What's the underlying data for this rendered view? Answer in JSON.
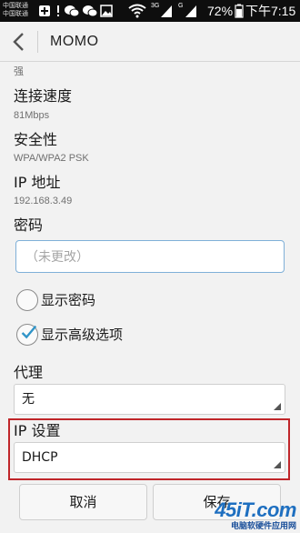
{
  "status_bar": {
    "carrier_1": "中国联通",
    "carrier_2": "中国联通",
    "network_label": "3G",
    "data_label": "G",
    "battery_percent": "72%",
    "time": "下午7:15",
    "battery_level": 0.72,
    "icons": [
      "add-icon",
      "notification-icon",
      "wechat-icon",
      "wechat-icon",
      "image-icon",
      "wifi-icon",
      "signal-icon",
      "signal-icon",
      "battery-icon"
    ]
  },
  "action_bar": {
    "back_icon": "chevron-left-icon",
    "title": "MOMO"
  },
  "signal_strength": {
    "value": "强"
  },
  "link_speed": {
    "label": "连接速度",
    "value": "81Mbps"
  },
  "security": {
    "label": "安全性",
    "value": "WPA/WPA2 PSK"
  },
  "ip_address": {
    "label": "IP 地址",
    "value": "192.168.3.49"
  },
  "password": {
    "label": "密码",
    "placeholder": "（未更改）"
  },
  "options": {
    "show_password": {
      "label": "显示密码",
      "checked": false
    },
    "show_advanced": {
      "label": "显示高级选项",
      "checked": true
    }
  },
  "proxy": {
    "label": "代理",
    "selected": "无"
  },
  "ip_settings": {
    "label": "IP 设置",
    "selected": "DHCP",
    "highlight_color": "#c0262a"
  },
  "buttons": {
    "cancel": "取消",
    "save": "保存"
  },
  "watermark": {
    "logo": "45iT.com",
    "subtitle": "电脑软硬件应用网"
  },
  "colors": {
    "accent": "#33b5e5",
    "input_border": "#7fb0d8",
    "status_bar_bg": "#0e0e0e"
  }
}
